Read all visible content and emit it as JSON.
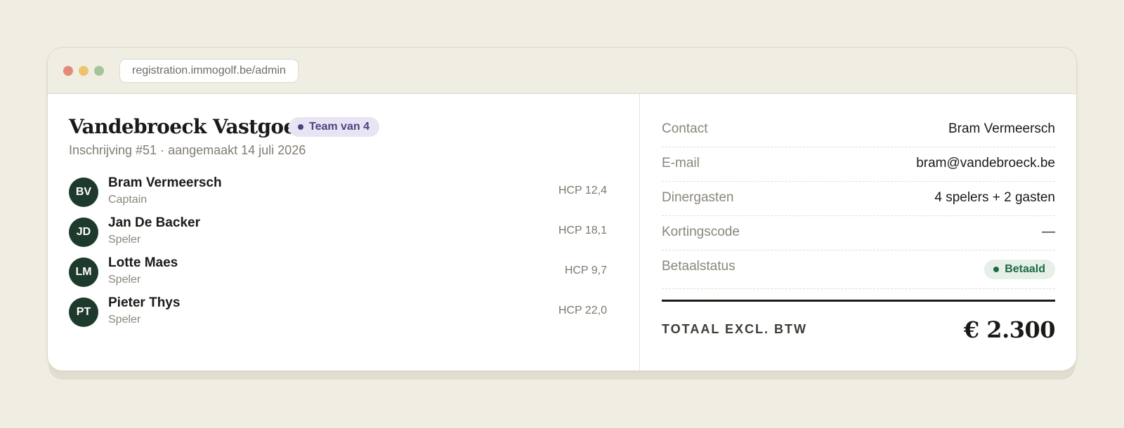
{
  "browser": {
    "url": "registration.immogolf.be/admin"
  },
  "registration": {
    "company": "Vandebroeck Vastgoed",
    "team_badge": "Team van 4",
    "subtitle": "Inschrijving #51 · aangemaakt 14 juli 2026",
    "players": [
      {
        "initials": "BV",
        "name": "Bram Vermeersch",
        "role": "Captain",
        "hcp": "HCP 12,4"
      },
      {
        "initials": "JD",
        "name": "Jan De Backer",
        "role": "Speler",
        "hcp": "HCP 18,1"
      },
      {
        "initials": "LM",
        "name": "Lotte Maes",
        "role": "Speler",
        "hcp": "HCP 9,7"
      },
      {
        "initials": "PT",
        "name": "Pieter Thys",
        "role": "Speler",
        "hcp": "HCP 22,0"
      }
    ]
  },
  "details": {
    "contact": {
      "label": "Contact",
      "value": "Bram Vermeersch"
    },
    "email": {
      "label": "E-mail",
      "value": "bram@vandebroeck.be"
    },
    "dinner": {
      "label": "Dinergasten",
      "value": "4 spelers + 2 gasten"
    },
    "discount": {
      "label": "Kortingscode",
      "value": "—"
    },
    "payment": {
      "label": "Betaalstatus",
      "value": "Betaald"
    }
  },
  "total": {
    "label": "TOTAAL EXCL. BTW",
    "value": "€ 2.300"
  },
  "colors": {
    "background": "#f0eee3",
    "avatar": "#1d3a2c",
    "team_badge_bg": "#e9e4f3",
    "team_badge_fg": "#4e4380",
    "paid_badge_bg": "#e6f0e8",
    "paid_badge_fg": "#1f6a43"
  }
}
